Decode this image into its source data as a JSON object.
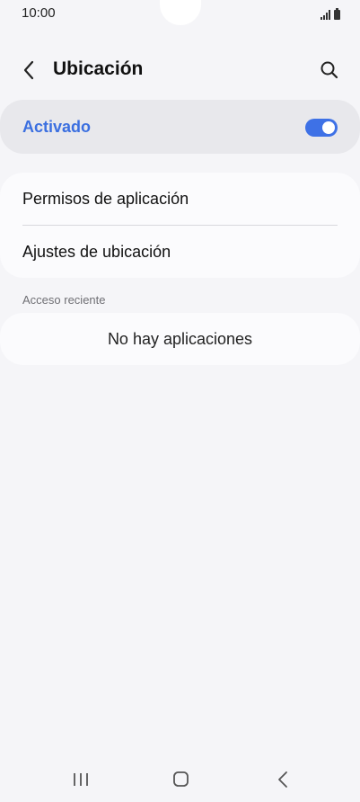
{
  "status_bar": {
    "time": "10:00",
    "icons": [
      "signal-icon",
      "battery-icon"
    ]
  },
  "header": {
    "title": "Ubicación",
    "back_icon": "chevron-left-icon",
    "search_icon": "search-icon"
  },
  "location_toggle": {
    "label": "Activado",
    "state": "on",
    "accent_color": "#3e71e6"
  },
  "settings": {
    "items": [
      {
        "label": "Permisos de aplicación"
      },
      {
        "label": "Ajustes de ubicación"
      }
    ]
  },
  "recent_access": {
    "section_label": "Acceso reciente",
    "empty_text": "No hay aplicaciones"
  },
  "nav_bar": {
    "icons": [
      "recent-apps-icon",
      "home-icon",
      "back-icon"
    ]
  }
}
